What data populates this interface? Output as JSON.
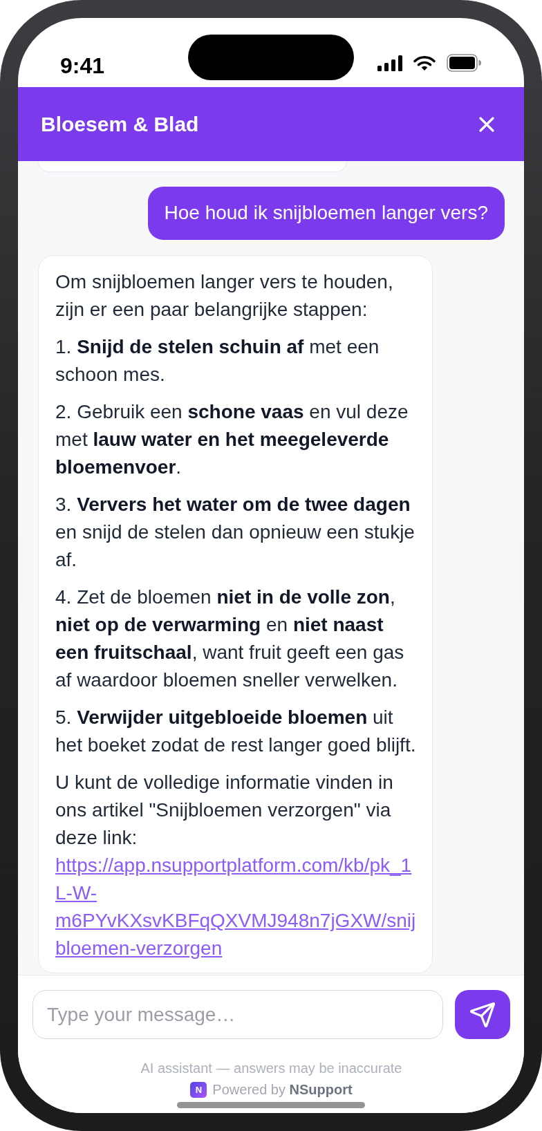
{
  "status_bar": {
    "time": "9:41"
  },
  "header": {
    "title": "Bloesem & Blad"
  },
  "messages": [
    {
      "kind": "bot",
      "cut_off": true
    },
    {
      "kind": "user",
      "cut_off": false,
      "text": "Hoe houd ik snijbloemen langer vers?"
    },
    {
      "kind": "bot",
      "cut_off": false,
      "paragraphs": [
        "Om snijbloemen langer vers te houden, zijn er een paar belangrijke stappen:",
        "1. **Snijd de stelen schuin af** met een schoon mes.",
        "2. Gebruik een **schone vaas** en vul deze met **lauw water en het meegeleverde bloemenvoer**.",
        "3. **Ververs het water om de twee dagen** en snijd de stelen dan opnieuw een stukje af.",
        "4. Zet de bloemen **niet in de volle zon**, **niet op de verwarming** en **niet naast een fruitschaal**, want fruit geeft een gas af waardoor bloemen sneller verwelken.",
        "5. **Verwijder uitgebloeide bloemen** uit het boeket zodat de rest langer goed blijft.",
        "U kunt de volledige informatie vinden in ons artikel \"Snijbloemen verzorgen\" via deze link:"
      ],
      "link": "https://app.nsupportplatform.com/kb/pk_1L-W-m6PYvKXsvKBFqQXVMJ948n7jGXW/snijbloemen-verzorgen"
    }
  ],
  "composer": {
    "placeholder": "Type your message…"
  },
  "footer": {
    "disclaimer": "AI assistant — answers may be inaccurate",
    "logo_letter": "N",
    "powered_by": "Powered by **NSupport**"
  }
}
